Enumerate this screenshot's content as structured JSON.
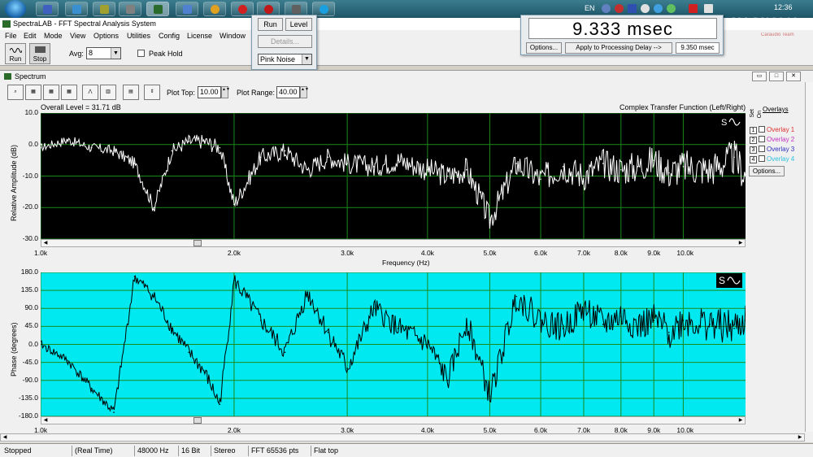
{
  "taskbar": {
    "language": "EN",
    "clock": "12:36"
  },
  "app": {
    "title": "SpectraLAB - FFT Spectral Analysis System",
    "menu": [
      "File",
      "Edit",
      "Mode",
      "View",
      "Options",
      "Utilities",
      "Config",
      "License",
      "Window"
    ]
  },
  "toolbar": {
    "run_label": "Run",
    "stop_label": "Stop",
    "avg_label": "Avg:",
    "avg_value": "8",
    "peak_hold_label": "Peak Hold"
  },
  "generator": {
    "run_label": "Run",
    "level_label": "Level",
    "details_label": "Details...",
    "signal_value": "Pink Noise"
  },
  "delay": {
    "display": "9.333 msec",
    "options_label": "Options...",
    "apply_label": "Apply to Processing Delay -->",
    "value": "9.350 msec"
  },
  "watermark": {
    "text": "MAGNOLIA",
    "sub": "Caraudio Team"
  },
  "spectrum": {
    "title": "Spectrum",
    "plot_top_label": "Plot Top:",
    "plot_top_value": "10.00",
    "plot_range_label": "Plot Range:",
    "plot_range_value": "40.00",
    "overall_level": "Overall Level = 31.71 dB",
    "function_label": "Complex Transfer Function (Left/Right)",
    "amp_ylabel": "Relative Amplitude (dB)",
    "phase_ylabel": "Phase  (degrees)",
    "xlabel": "Frequency (Hz)",
    "amp_yticks": [
      "10.0",
      "0.0",
      "-10.0",
      "-20.0",
      "-30.0"
    ],
    "phase_yticks": [
      "180.0",
      "135.0",
      "90.0",
      "45.0",
      "0.0",
      "-45.0",
      "-90.0",
      "-135.0",
      "-180.0"
    ],
    "xticks": [
      "1.0k",
      "2.0k",
      "3.0k",
      "4.0k",
      "5.0k",
      "6.0k",
      "7.0k",
      "8.0k",
      "9.0k",
      "10.0k"
    ],
    "icon_text": "S",
    "set_label": "Set",
    "on_label": "On",
    "overlays_title": "Overlays",
    "overlays": [
      {
        "num": "1",
        "label": "Overlay 1",
        "color": "#e03030"
      },
      {
        "num": "2",
        "label": "Overlay 2",
        "color": "#c030c0"
      },
      {
        "num": "3",
        "label": "Overlay 3",
        "color": "#3030c0"
      },
      {
        "num": "4",
        "label": "Overlay 4",
        "color": "#30c0e0"
      }
    ],
    "options_label": "Options..."
  },
  "status": {
    "state": "Stopped",
    "mode": "(Real Time)",
    "rate": "48000 Hz",
    "bits": "16 Bit",
    "channels": "Stereo",
    "fft": "FFT 65536 pts",
    "window": "Flat top"
  },
  "colors": {
    "amp_background": "#000000",
    "amp_trace": "#ffffff",
    "phase_background": "#00e8f0",
    "phase_trace": "#000000",
    "grid": "#1a8a1a"
  },
  "chart_data": [
    {
      "type": "line",
      "xlabel": "Frequency (Hz)",
      "ylabel": "Relative Amplitude (dB)",
      "xscale": "log",
      "xlim": [
        1000,
        12500
      ],
      "ylim": [
        -30,
        10
      ],
      "x": [
        1000,
        1100,
        1200,
        1300,
        1400,
        1500,
        1600,
        1700,
        1800,
        1900,
        2000,
        2200,
        2400,
        2600,
        2800,
        3000,
        3300,
        3600,
        4000,
        4300,
        4600,
        5000,
        5500,
        6000,
        6500,
        7000,
        7500,
        8000,
        8500,
        9000,
        9500,
        10000,
        11000,
        12000,
        12500
      ],
      "series": [
        {
          "values": [
            -1,
            1.5,
            -1,
            -2,
            -6,
            -20,
            -2,
            1,
            1,
            -1,
            -19,
            -4,
            -2,
            -8,
            -4,
            -6,
            -7,
            -5,
            -8,
            -10,
            -8,
            -24,
            -6,
            -11,
            -7,
            -10,
            -6,
            -8,
            -7,
            -5,
            -9,
            -7,
            -8,
            -4,
            -10
          ]
        }
      ]
    },
    {
      "type": "line",
      "xlabel": "Frequency (Hz)",
      "ylabel": "Phase  (degrees)",
      "xscale": "log",
      "xlim": [
        1000,
        12500
      ],
      "ylim": [
        -180,
        180
      ],
      "x": [
        1000,
        1100,
        1200,
        1300,
        1400,
        1500,
        1600,
        1700,
        1800,
        1900,
        2000,
        2200,
        2400,
        2600,
        2800,
        3000,
        3300,
        3600,
        4000,
        4300,
        4600,
        5000,
        5500,
        6000,
        6500,
        7000,
        7500,
        8000,
        8500,
        9000,
        9500,
        10000,
        11000,
        12000,
        12500
      ],
      "series": [
        {
          "values": [
            0,
            -40,
            -110,
            -170,
            170,
            120,
            40,
            -20,
            -70,
            -150,
            160,
            60,
            -20,
            130,
            30,
            -60,
            90,
            40,
            0,
            -90,
            60,
            -130,
            120,
            60,
            40,
            90,
            50,
            70,
            45,
            60,
            30,
            60,
            50,
            40,
            60
          ]
        }
      ]
    }
  ]
}
